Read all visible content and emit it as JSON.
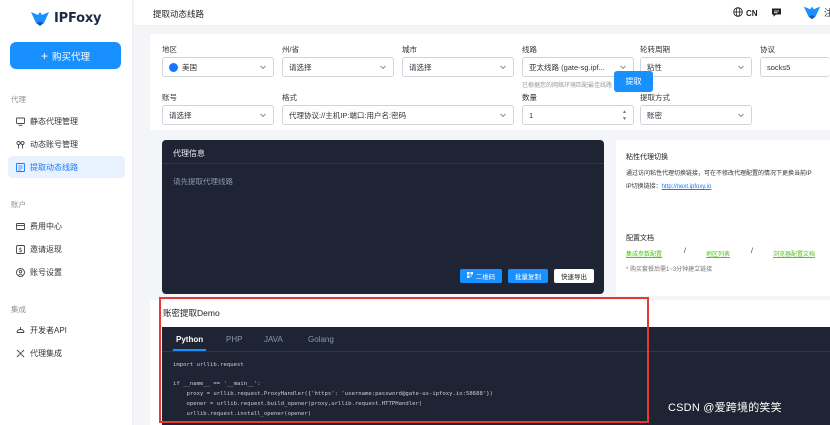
{
  "app": {
    "brand": "IPFoxy",
    "buy_button": "购买代理"
  },
  "sidebar": {
    "sections": [
      {
        "label": "代理",
        "items": [
          {
            "label": "静态代理管理",
            "icon": "monitor-icon",
            "active": false
          },
          {
            "label": "动态账号管理",
            "icon": "key-icon",
            "active": false
          },
          {
            "label": "提取动态线路",
            "icon": "list-icon",
            "active": true
          }
        ]
      },
      {
        "label": "账户",
        "items": [
          {
            "label": "费用中心",
            "icon": "card-icon",
            "active": false
          },
          {
            "label": "邀请返现",
            "icon": "dollar-icon",
            "active": false
          },
          {
            "label": "账号设置",
            "icon": "user-icon",
            "active": false
          }
        ]
      },
      {
        "label": "集成",
        "items": [
          {
            "label": "开发者API",
            "icon": "api-icon",
            "active": false
          },
          {
            "label": "代理集成",
            "icon": "integration-icon",
            "active": false
          }
        ]
      }
    ]
  },
  "header": {
    "title": "提取动态线路",
    "lang": "CN",
    "extra": "注"
  },
  "form": {
    "region": {
      "label": "地区",
      "value": "美国"
    },
    "state": {
      "label": "州/省",
      "value": "请选择"
    },
    "city": {
      "label": "城市",
      "value": "请选择"
    },
    "route": {
      "label": "线路",
      "value": "亚太线路 (gate-sg.ipf...",
      "hint": "已根据您的网络环境匹配最佳线路"
    },
    "rotation": {
      "label": "轮转周期",
      "value": "粘性"
    },
    "protocol": {
      "label": "协议",
      "value": "socks5"
    },
    "account": {
      "label": "账号",
      "value": "请选择"
    },
    "format": {
      "label": "格式",
      "value": "代理协议://主机IP:端口:用户名:密码"
    },
    "quantity": {
      "label": "数量",
      "value": "1"
    },
    "method": {
      "label": "提取方式",
      "value": "账密"
    },
    "extract_button": "提取"
  },
  "proxy_info": {
    "title": "代理信息",
    "placeholder": "请先提取代理线路",
    "qr_button": "二维码",
    "copy_button": "批量复制",
    "export_button": "快速导出"
  },
  "info_panel": {
    "sticky_title": "粘性代理切换",
    "sticky_desc": "通过访问粘性代理切换链接，可在不修改代理配置的情况下更换当前IP",
    "switch_label": "IP切换链接：",
    "switch_link": "http://next.ipfoxy.io",
    "docs_title": "配置文档",
    "doc_links": [
      "集成参数配置",
      "地区列表",
      "浏览器配置文档"
    ],
    "note": "* 购买套餐后需1~3分钟建立链接"
  },
  "demo": {
    "title": "账密提取Demo",
    "tabs": [
      "Python",
      "PHP",
      "JAVA",
      "Golang"
    ],
    "active_tab": "Python",
    "code_lines": [
      "import urllib.request",
      "",
      "if __name__ == '__main__':",
      "    proxy = urllib.request.ProxyHandler({'https': 'username:password@gate-us-ipfoxy.io:58688'})",
      "    opener = urllib.request.build_opener(proxy,urllib.request.HTTPHandler)",
      "    urllib.request.install_opener(opener)"
    ]
  },
  "watermark": "CSDN @爱跨境的笑笑",
  "colors": {
    "accent": "#1990ff",
    "dark_card": "#1e2433",
    "highlight": "#e53935",
    "link_green": "#52c41a"
  }
}
